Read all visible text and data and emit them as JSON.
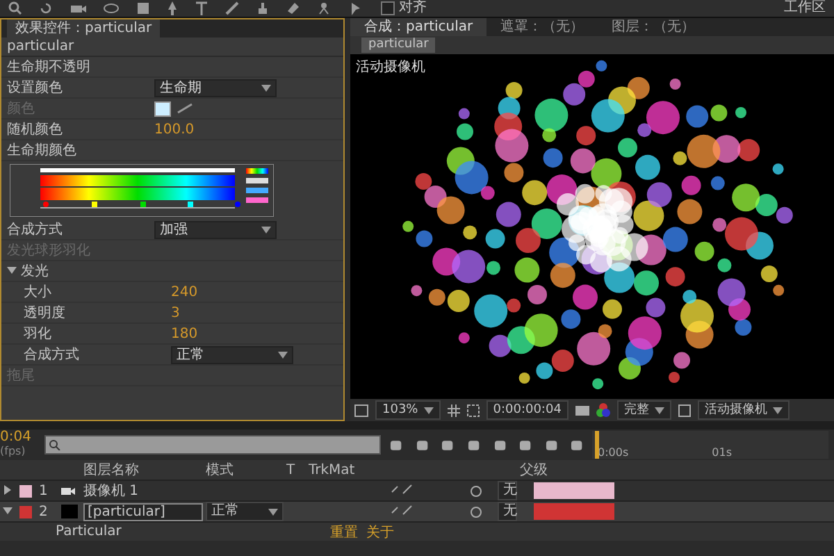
{
  "toolbar": {
    "snap": {
      "label": "对齐",
      "checked": false
    },
    "workspace_label": "工作区"
  },
  "effects": {
    "tab": "效果控件：particular",
    "layer": "particular",
    "properties": [
      {
        "kind": "label",
        "label": "生命期不透明"
      },
      {
        "kind": "dropdown",
        "label": "设置颜色",
        "value": "生命期"
      },
      {
        "kind": "swatch",
        "label": "颜色",
        "disabled": true
      },
      {
        "kind": "number",
        "label": "随机颜色",
        "value": "100.0"
      },
      {
        "kind": "gradient",
        "label": "生命期颜色"
      },
      {
        "kind": "dropdown",
        "label": "合成方式",
        "value": "加强"
      },
      {
        "kind": "label",
        "label": "发光球形羽化",
        "disabled": true
      },
      {
        "kind": "group",
        "label": "发光",
        "expanded": true,
        "children": [
          {
            "kind": "number",
            "label": "大小",
            "value": "240"
          },
          {
            "kind": "number",
            "label": "透明度",
            "value": "3"
          },
          {
            "kind": "number",
            "label": "羽化",
            "value": "180"
          },
          {
            "kind": "dropdown",
            "label": "合成方式",
            "value": "正常"
          }
        ]
      },
      {
        "kind": "label",
        "label": "拖尾",
        "disabled": true
      }
    ]
  },
  "viewer": {
    "tabs": [
      {
        "label": "合成：particular",
        "selected": true
      },
      {
        "label": "遮罩：（无）",
        "selected": false
      },
      {
        "label": "图层：（无）",
        "selected": false
      }
    ],
    "comp_tab": "particular",
    "camera_label": "活动摄像机",
    "zoom": "103%",
    "timecode": "0:00:00:04",
    "resolution": "完整",
    "view": "活动摄像机"
  },
  "timeline": {
    "current_time": "0:04",
    "fps": "(fps)",
    "columns": [
      "图层名称",
      "模式",
      "T",
      "TrkMat",
      "父级"
    ],
    "ruler": [
      "0:00s",
      "01s"
    ],
    "layers": [
      {
        "index": "1",
        "name": "摄像机 1",
        "kind": "camera",
        "color": "#e8b8cc",
        "expanded": false,
        "selected": false,
        "parent": "无"
      },
      {
        "index": "2",
        "name": "[particular]",
        "kind": "solid",
        "color": "#d03434",
        "expanded": true,
        "selected": true,
        "mode": "正常",
        "parent": "无"
      }
    ],
    "effect_row": "Particular",
    "effect_links": [
      "重置",
      "关于"
    ]
  }
}
